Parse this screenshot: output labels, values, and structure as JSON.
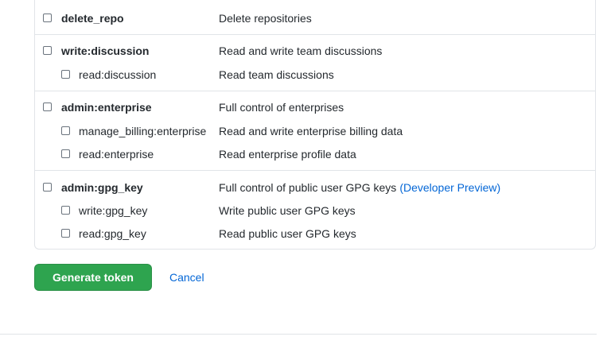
{
  "scopes": [
    {
      "name": "delete_repo",
      "description": "Delete repositories",
      "children": []
    },
    {
      "name": "write:discussion",
      "description": "Read and write team discussions",
      "children": [
        {
          "name": "read:discussion",
          "description": "Read team discussions"
        }
      ]
    },
    {
      "name": "admin:enterprise",
      "description": "Full control of enterprises",
      "children": [
        {
          "name": "manage_billing:enterprise",
          "description": "Read and write enterprise billing data"
        },
        {
          "name": "read:enterprise",
          "description": "Read enterprise profile data"
        }
      ]
    },
    {
      "name": "admin:gpg_key",
      "description": "Full control of public user GPG keys",
      "preview_label": "(Developer Preview)",
      "children": [
        {
          "name": "write:gpg_key",
          "description": "Write public user GPG keys"
        },
        {
          "name": "read:gpg_key",
          "description": "Read public user GPG keys"
        }
      ]
    }
  ],
  "actions": {
    "generate_label": "Generate token",
    "cancel_label": "Cancel"
  },
  "colors": {
    "primary_button": "#2ea44f",
    "link": "#0366d6",
    "border": "#e1e4e8"
  }
}
